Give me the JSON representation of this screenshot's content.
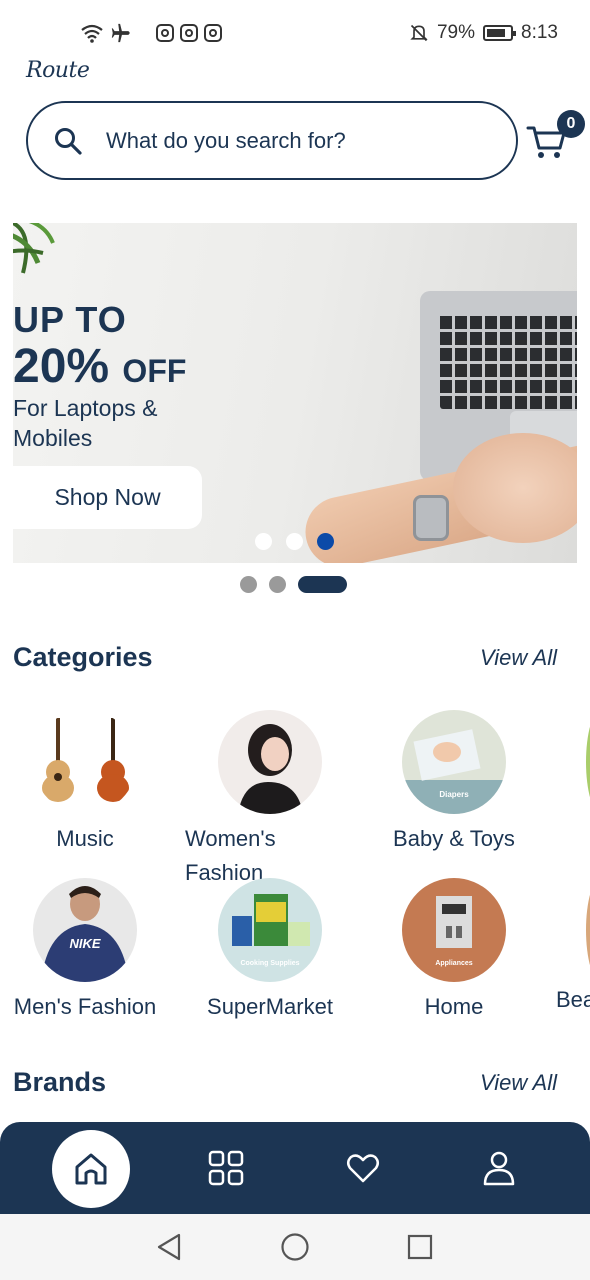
{
  "status_bar": {
    "battery": "79%",
    "time": "8:13"
  },
  "header": {
    "logo": "Route",
    "search_placeholder": "What do you search for?",
    "cart_count": "0"
  },
  "banner": {
    "line1": "UP TO",
    "line2_percent": "20%",
    "line2_off": "OFF",
    "line3": "For Laptops & Mobiles",
    "button": "Shop Now",
    "active_slide": 3,
    "slide_count": 3
  },
  "pager": {
    "active_page": 3,
    "page_count": 3
  },
  "categories": {
    "title": "Categories",
    "view_all": "View All",
    "items": [
      {
        "label": "Music"
      },
      {
        "label": "Women's Fashion"
      },
      {
        "label": "Baby & Toys"
      },
      {
        "label": "Men's Fashion"
      },
      {
        "label": "SuperMarket"
      },
      {
        "label": "Home"
      },
      {
        "label": "Bea"
      }
    ],
    "image_text": {
      "baby": "Diapers",
      "men": "NIKE",
      "supermarket": "Cooking Supplies",
      "home": "Appliances"
    }
  },
  "brands": {
    "title": "Brands",
    "view_all": "View All"
  },
  "colors": {
    "primary": "#1c3553",
    "accent_dot": "#0b4aa8",
    "inactive_dot": "#9a9a9a"
  },
  "bottom_nav": {
    "items": [
      "home-icon",
      "grid-icon",
      "heart-icon",
      "person-icon"
    ],
    "active": "home-icon"
  },
  "android_nav": [
    "back-icon",
    "home-circle-icon",
    "recents-icon"
  ]
}
